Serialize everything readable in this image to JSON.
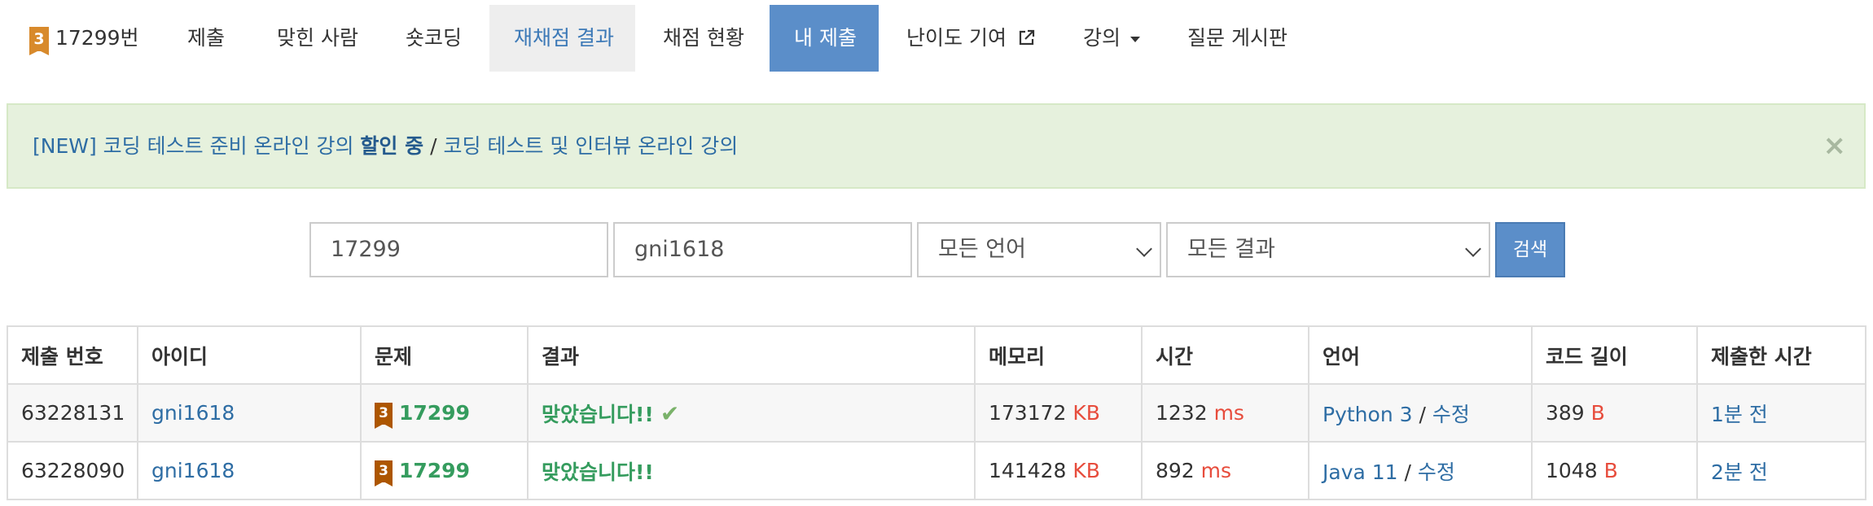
{
  "nav": {
    "tier_badge": "3",
    "items": [
      {
        "label": "17299번"
      },
      {
        "label": "제출"
      },
      {
        "label": "맞힌 사람"
      },
      {
        "label": "숏코딩"
      },
      {
        "label": "재채점 결과"
      },
      {
        "label": "채점 현황"
      },
      {
        "label": "내 제출"
      },
      {
        "label": "난이도 기여"
      },
      {
        "label": "강의"
      },
      {
        "label": "질문 게시판"
      }
    ],
    "active_color": "#5b8ec9",
    "external_icon": "external-link-icon",
    "dropdown_icon": "caret-down-icon"
  },
  "alert": {
    "prefix": "[NEW] 코딩 테스트 준비 온라인 강의 ",
    "bold": "할인 중",
    "separator": " / ",
    "suffix": "코딩 테스트 및 인터뷰 온라인 강의",
    "close": "×",
    "background": "#e6f1dd"
  },
  "search": {
    "problem_id": "17299",
    "user_id": "gni1618",
    "language": "모든 언어",
    "result": "모든 결과",
    "button": "검색"
  },
  "table": {
    "headers": [
      "제출 번호",
      "아이디",
      "문제",
      "결과",
      "메모리",
      "시간",
      "언어",
      "코드 길이",
      "제출한 시간"
    ],
    "rows": [
      {
        "submission_id": "63228131",
        "user": "gni1618",
        "tier": "3",
        "problem": "17299",
        "result": "맞았습니다!!",
        "memory": "173172",
        "memory_unit": "KB",
        "time": "1232",
        "time_unit": "ms",
        "language": "Python 3",
        "lang_sep": " / ",
        "edit": "수정",
        "code_length": "389",
        "code_unit": "B",
        "submitted": "1분 전"
      },
      {
        "submission_id": "63228090",
        "user": "gni1618",
        "tier": "3",
        "problem": "17299",
        "result": "맞았습니다!!",
        "memory": "141428",
        "memory_unit": "KB",
        "time": "892",
        "time_unit": "ms",
        "language": "Java 11",
        "lang_sep": " / ",
        "edit": "수정",
        "code_length": "1048",
        "code_unit": "B",
        "submitted": "2분 전"
      }
    ]
  }
}
